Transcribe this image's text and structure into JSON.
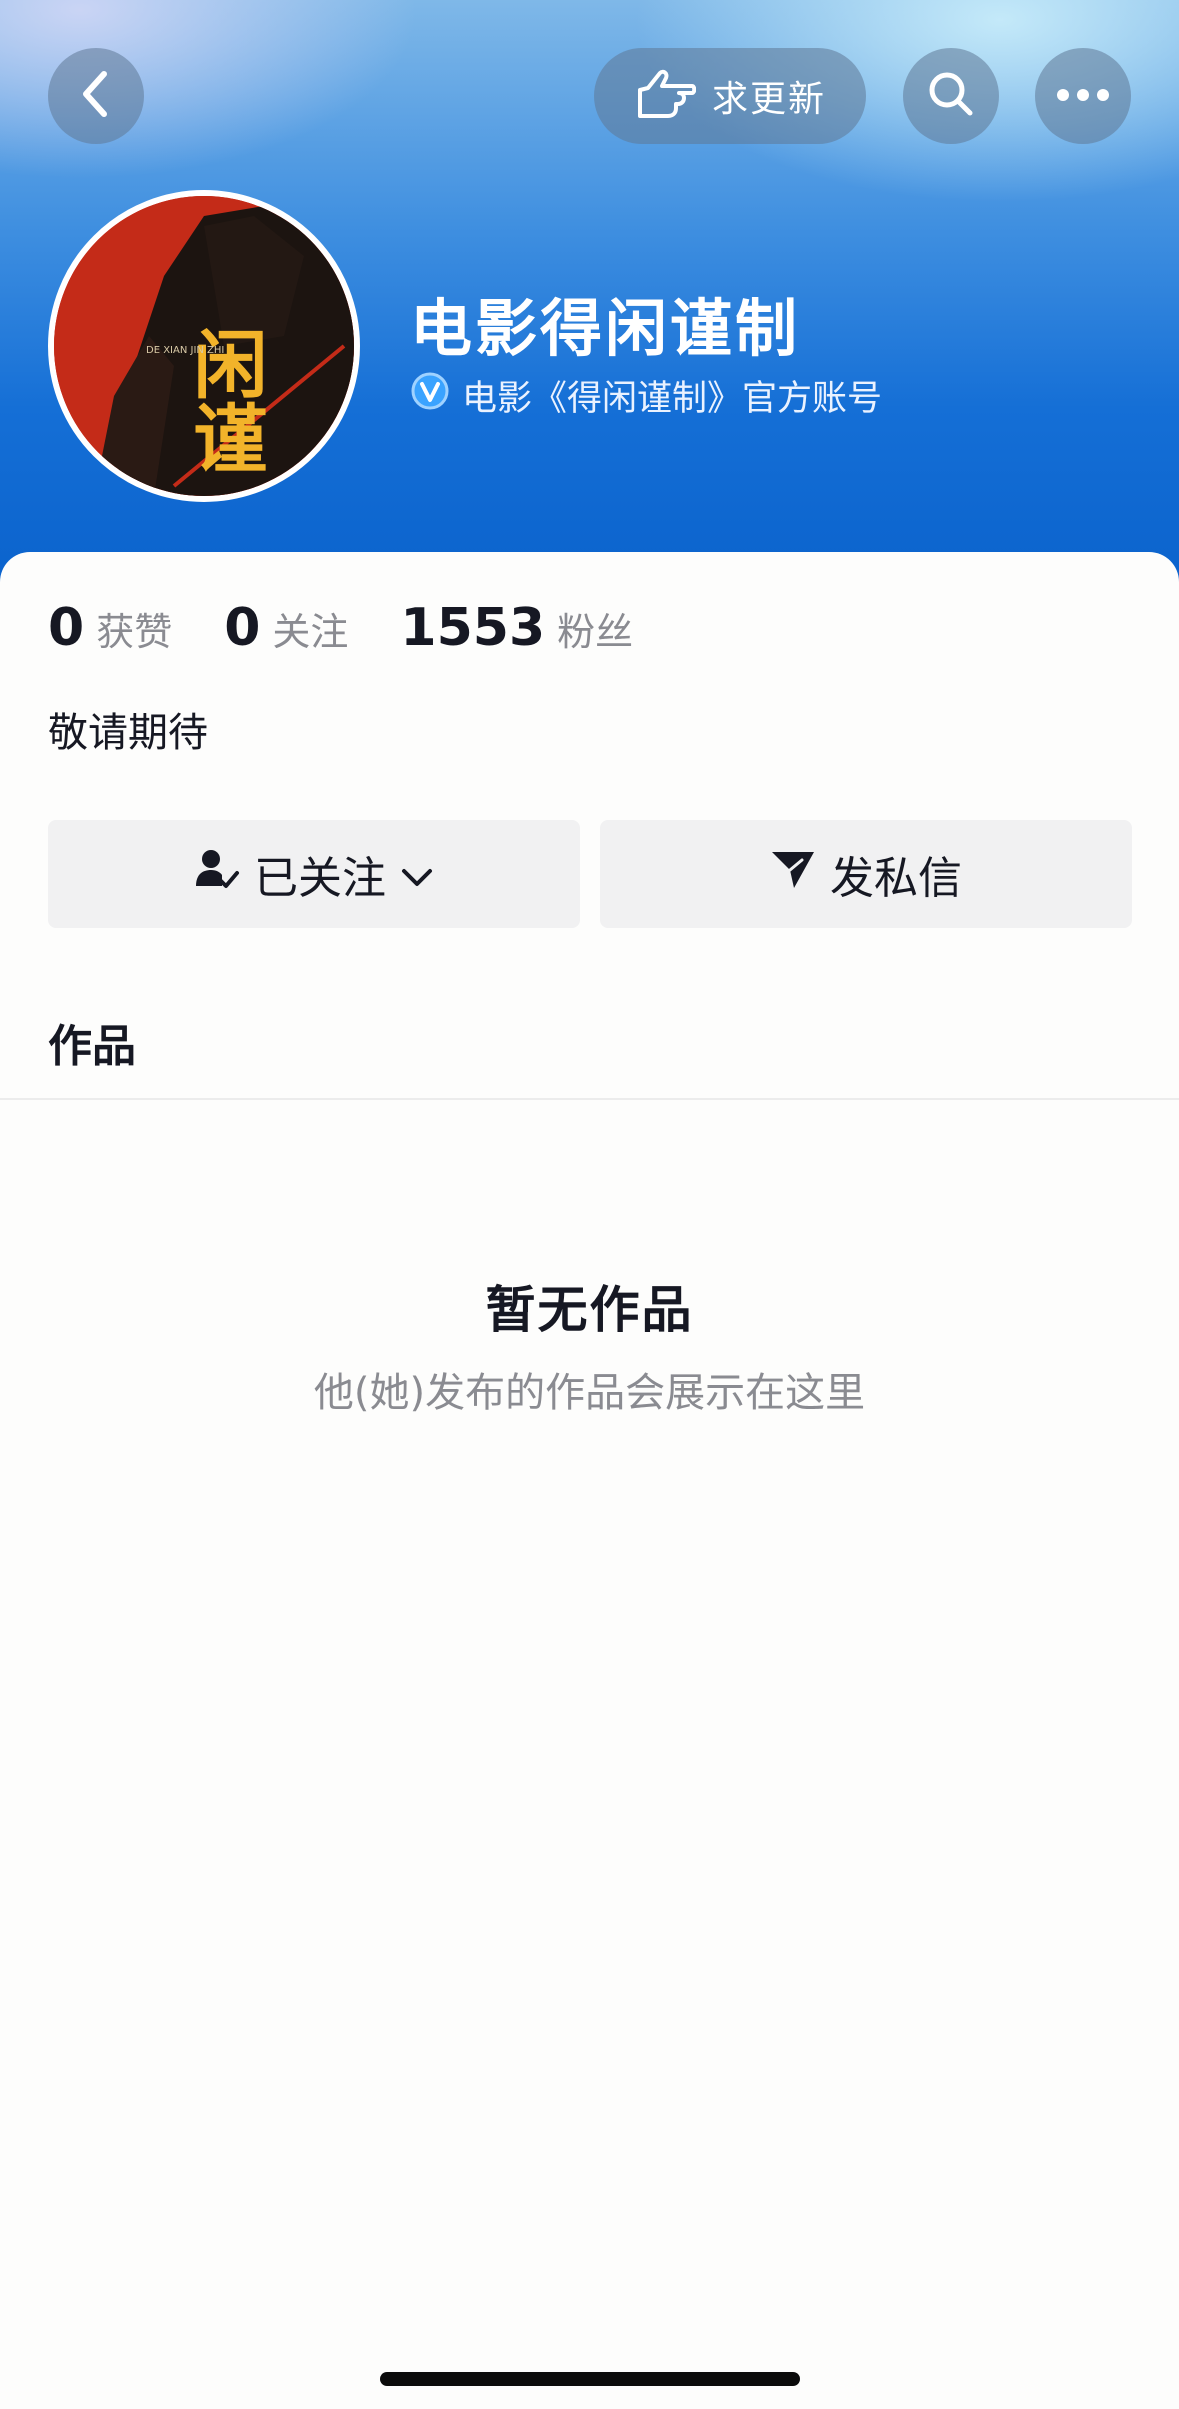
{
  "header": {
    "request_update_label": "求更新",
    "icons": [
      "back-chevron-icon",
      "pointing-hand-icon",
      "search-icon",
      "more-dots-icon"
    ]
  },
  "profile": {
    "name": "电影得闲谨制",
    "verification_text": "电影《得闲谨制》官方账号",
    "verified_icon": "verified-v-icon",
    "avatar_title": "闲谨",
    "avatar_subtitle": "DE XIAN JIN ZHI"
  },
  "stats": [
    {
      "value": "0",
      "label": "获赞"
    },
    {
      "value": "0",
      "label": "关注"
    },
    {
      "value": "1553",
      "label": "粉丝"
    }
  ],
  "bio": "敬请期待",
  "actions": {
    "followed_label": "已关注",
    "message_label": "发私信"
  },
  "tabs": {
    "works_label": "作品"
  },
  "empty_state": {
    "title": "暂无作品",
    "subtitle": "他(她)发布的作品会展示在这里"
  },
  "colors": {
    "header_top": "#7fb8e8",
    "header_bottom": "#0a62cc",
    "text_primary": "#161823",
    "text_secondary": "#8a8b91",
    "button_bg": "#f1f1f2",
    "avatar_red": "#c42b18",
    "avatar_gold": "#f2b32a"
  }
}
